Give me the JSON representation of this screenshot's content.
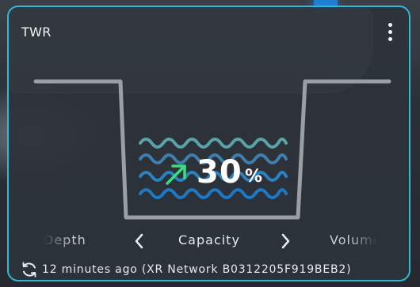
{
  "widget": {
    "title": "TWR",
    "menu_icon": "kebab-menu-icon"
  },
  "gauge": {
    "value": "30",
    "unit": "%",
    "level_fraction": 0.3,
    "trend_icon": "arrow-up-right-icon",
    "trend_color": "#3ddc84",
    "wave_colors": [
      "#5aa3a8",
      "#3f7fb0",
      "#2a82c0",
      "#1e78c8"
    ]
  },
  "carousel": {
    "prev_label": "Depth",
    "current_label": "Capacity",
    "next_label": "Volume"
  },
  "footer": {
    "refresh_icon": "refresh-icon",
    "status_text": "12 minutes ago (XR Network B0312205F919BEB2)"
  },
  "colors": {
    "border_accent": "#2fb9d6",
    "tank_outline": "#9a9fa5"
  }
}
